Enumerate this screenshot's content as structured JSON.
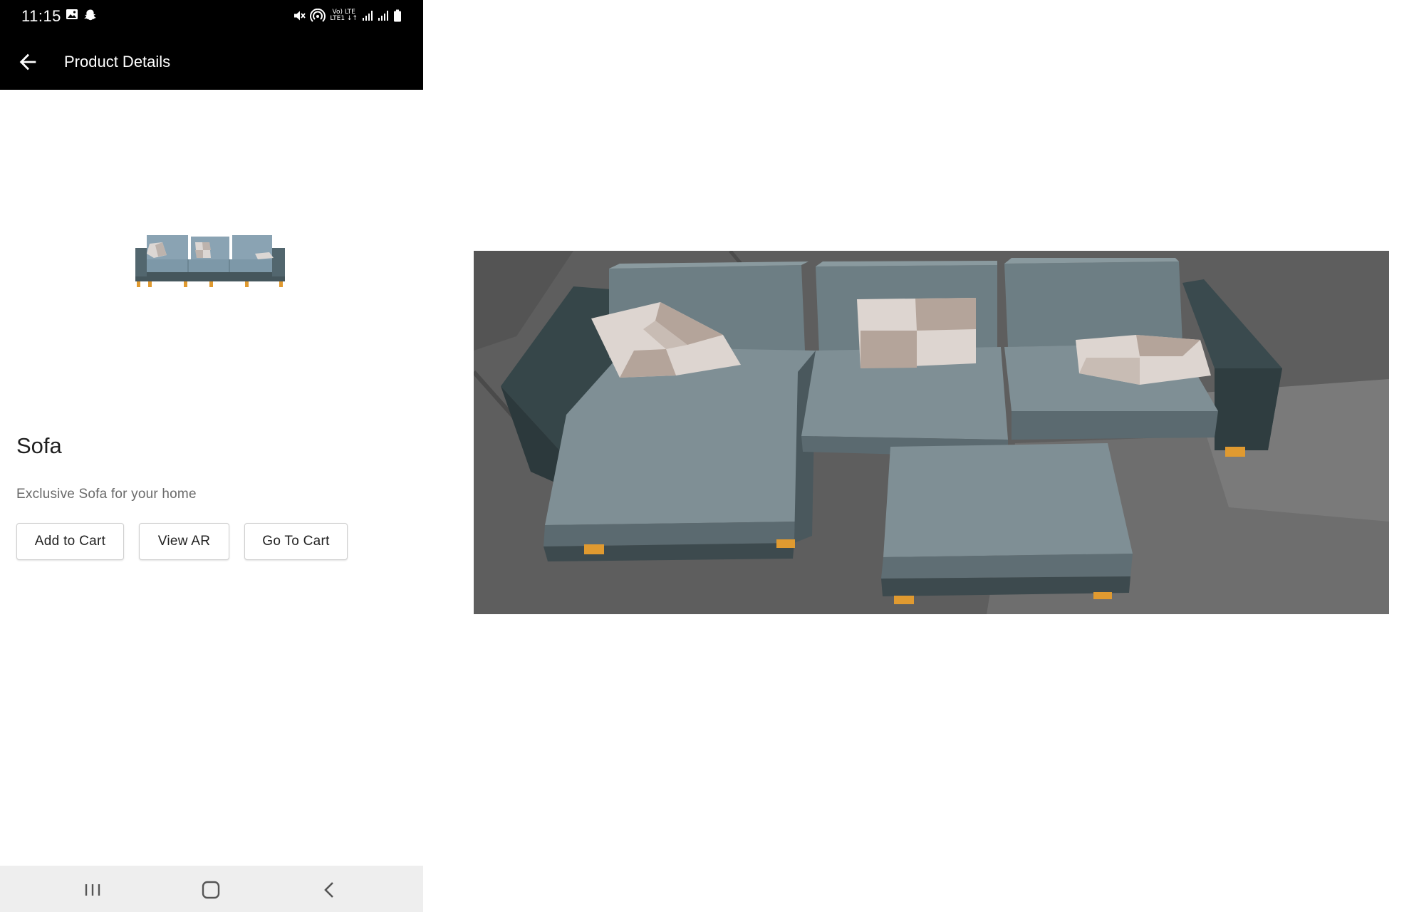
{
  "status_bar": {
    "time": "11:15",
    "left_icons": [
      "image-icon",
      "snapchat-icon"
    ],
    "right_icons": [
      "mute-icon",
      "hotspot-icon",
      "volte-lte1-icon",
      "lte-data-icon",
      "signal-icon",
      "signal-icon",
      "battery-icon"
    ],
    "volte_label_top": "Vo) LTE",
    "volte_label_bottom": "LTE1 ↓↑"
  },
  "app_bar": {
    "title": "Product Details",
    "back_icon": "arrow-back-icon"
  },
  "product": {
    "name": "Sofa",
    "description": "Exclusive Sofa for your home"
  },
  "buttons": {
    "add_to_cart": "Add to Cart",
    "view_ar": "View AR",
    "go_to_cart": "Go To Cart"
  },
  "nav_bar": {
    "items": [
      "recents-icon",
      "home-icon",
      "back-icon"
    ]
  },
  "colors": {
    "app_bar_bg": "#000000",
    "sofa_body": "#7c8c93",
    "sofa_dark": "#4a5a60",
    "cushion": "#b8ada7",
    "leg": "#e09a30",
    "floor": "#606060"
  }
}
